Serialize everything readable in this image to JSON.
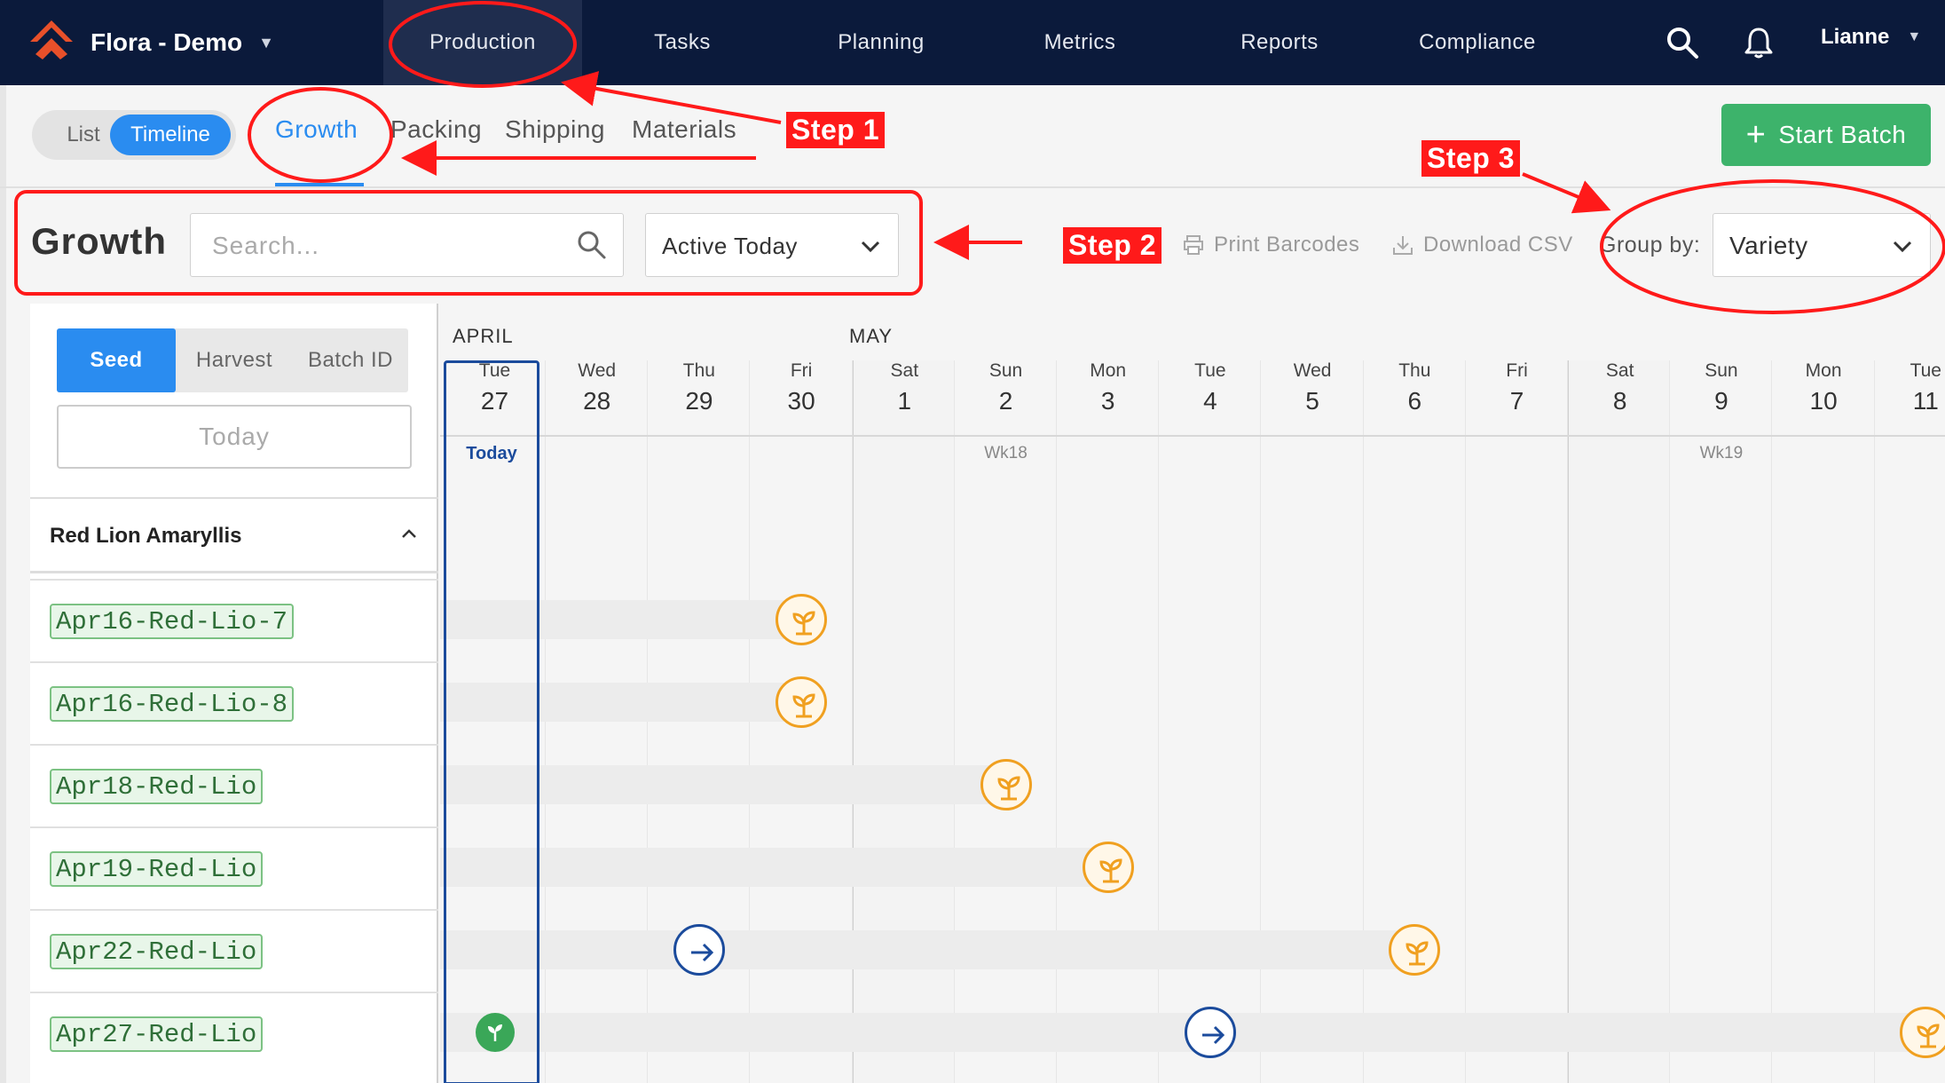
{
  "navbar": {
    "brand": "Flora - Demo",
    "items": [
      {
        "label": "Production"
      },
      {
        "label": "Tasks"
      },
      {
        "label": "Planning"
      },
      {
        "label": "Metrics"
      },
      {
        "label": "Reports"
      },
      {
        "label": "Compliance"
      }
    ],
    "user": "Lianne",
    "colors": {
      "bg": "#0b1a3b",
      "active": "#1f2d4e",
      "logo": "#e8502a"
    }
  },
  "view_toggle": {
    "list": "List",
    "timeline": "Timeline"
  },
  "subtabs": [
    {
      "label": "Growth"
    },
    {
      "label": "Packing"
    },
    {
      "label": "Shipping"
    },
    {
      "label": "Materials"
    }
  ],
  "start_batch": "Start Batch",
  "toolbar": {
    "title": "Growth",
    "search_placeholder": "Search...",
    "filter_value": "Active Today",
    "print_barcodes": "Print Barcodes",
    "download_csv": "Download CSV",
    "group_by_label": "Group by:",
    "group_by_value": "Variety"
  },
  "left_panel": {
    "segments": [
      "Seed",
      "Harvest",
      "Batch ID"
    ],
    "today_button": "Today",
    "group_name": "Red Lion Amaryllis",
    "batches": [
      "Apr16-Red-Lio-7",
      "Apr16-Red-Lio-8",
      "Apr18-Red-Lio",
      "Apr19-Red-Lio",
      "Apr22-Red-Lio",
      "Apr27-Red-Lio"
    ]
  },
  "calendar": {
    "months": [
      "APRIL",
      "MAY"
    ],
    "today_label": "Today",
    "days": [
      {
        "name": "Tue",
        "date": "27",
        "week": ""
      },
      {
        "name": "Wed",
        "date": "28",
        "week": ""
      },
      {
        "name": "Thu",
        "date": "29",
        "week": ""
      },
      {
        "name": "Fri",
        "date": "30",
        "week": ""
      },
      {
        "name": "Sat",
        "date": "1",
        "week": ""
      },
      {
        "name": "Sun",
        "date": "2",
        "week": "Wk18"
      },
      {
        "name": "Mon",
        "date": "3",
        "week": ""
      },
      {
        "name": "Tue",
        "date": "4",
        "week": ""
      },
      {
        "name": "Wed",
        "date": "5",
        "week": ""
      },
      {
        "name": "Thu",
        "date": "6",
        "week": ""
      },
      {
        "name": "Fri",
        "date": "7",
        "week": ""
      },
      {
        "name": "Sat",
        "date": "8",
        "week": ""
      },
      {
        "name": "Sun",
        "date": "9",
        "week": "Wk19"
      },
      {
        "name": "Mon",
        "date": "10",
        "week": ""
      },
      {
        "name": "Tue",
        "date": "11",
        "week": ""
      }
    ],
    "rows": [
      {
        "bar_end_day": 3,
        "markers": [
          {
            "day": 3,
            "type": "harvest"
          }
        ]
      },
      {
        "bar_end_day": 3,
        "markers": [
          {
            "day": 3,
            "type": "harvest"
          }
        ]
      },
      {
        "bar_end_day": 5,
        "markers": [
          {
            "day": 5,
            "type": "harvest"
          }
        ]
      },
      {
        "bar_end_day": 6,
        "markers": [
          {
            "day": 6,
            "type": "harvest"
          }
        ]
      },
      {
        "bar_end_day": 9,
        "markers": [
          {
            "day": 2,
            "type": "move"
          },
          {
            "day": 9,
            "type": "harvest"
          }
        ]
      },
      {
        "bar_end_day": 14,
        "markers": [
          {
            "day": 0,
            "type": "seed"
          },
          {
            "day": 7,
            "type": "move"
          },
          {
            "day": 14,
            "type": "harvest"
          }
        ]
      }
    ],
    "colors": {
      "harvest": "#f0a020",
      "move": "#1b4b9c",
      "seed": "#3aa758",
      "today": "#1b4b9c"
    }
  },
  "annotations": {
    "step1": "Step 1",
    "step2": "Step 2",
    "step3": "Step 3",
    "color": "#ff1a1a"
  }
}
